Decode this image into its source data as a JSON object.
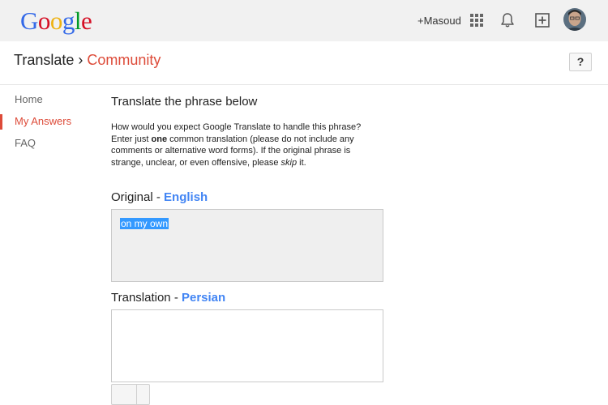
{
  "topbar": {
    "logo_letters": [
      {
        "char": "G",
        "color": "#3369e8"
      },
      {
        "char": "o",
        "color": "#d50f25"
      },
      {
        "char": "o",
        "color": "#eeb211"
      },
      {
        "char": "g",
        "color": "#3369e8"
      },
      {
        "char": "l",
        "color": "#009925"
      },
      {
        "char": "e",
        "color": "#d50f25"
      }
    ],
    "user_link": "+Masoud",
    "icons": [
      "apps-grid-icon",
      "notifications-bell-icon",
      "share-plus-icon",
      "avatar"
    ]
  },
  "header": {
    "breadcrumb_root": "Translate",
    "breadcrumb_sep": " › ",
    "breadcrumb_current": "Community",
    "help_label": "?"
  },
  "nav": {
    "items": [
      {
        "label": "Home",
        "active": false
      },
      {
        "label": "My Answers",
        "active": true
      },
      {
        "label": "FAQ",
        "active": false
      }
    ]
  },
  "main": {
    "title": "Translate the phrase below",
    "instructions": {
      "part1": "How would you expect Google Translate to handle this phrase? Enter just ",
      "bold": "one",
      "part2": " common translation (please do not include any comments or alternative word forms). If the original phrase is strange, unclear, or even offensive, please ",
      "italic": "skip",
      "part3": " it."
    },
    "original": {
      "label": "Original - ",
      "language": "English",
      "text": "on my own"
    },
    "translation": {
      "label": "Translation - ",
      "language": "Persian",
      "value": ""
    }
  },
  "colors": {
    "accent_red": "#dd4b39",
    "link_blue": "#4285f4",
    "topbar_bg": "#f1f1f1",
    "selection_blue": "#3399ff"
  }
}
